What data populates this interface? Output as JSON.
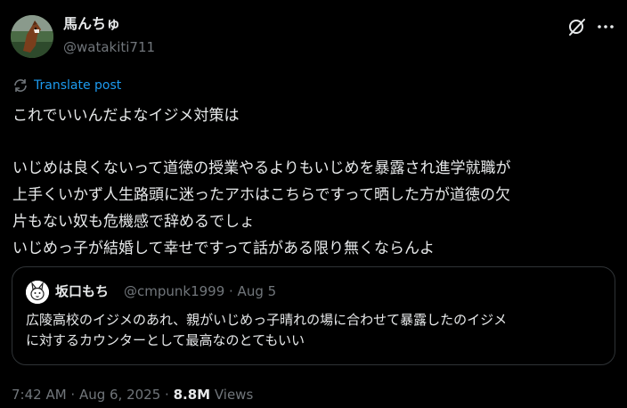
{
  "author": {
    "display_name": "馬んちゅ",
    "handle": "@watakiti711"
  },
  "translate": {
    "label": "Translate post"
  },
  "post": {
    "lines": [
      "これでいいんだよなイジメ対策は",
      "",
      "いじめは良くないって道徳の授業やるよりもいじめを暴露され進学就職が",
      "上手くいかず人生路頭に迷ったアホはこちらですって晒した方が道徳の欠",
      "片もない奴も危機感で辞めるでしょ",
      "いじめっ子が結婚して幸せですって話がある限り無くならんよ"
    ]
  },
  "quote": {
    "display_name": "坂口もち",
    "handle_date": "@cmpunk1999 · Aug 5",
    "lines": [
      "広陵高校のイジメのあれ、親がいじめっ子晴れの場に合わせて暴露したのイジメ",
      "に対するカウンターとして最高なのとてもいい"
    ]
  },
  "footer": {
    "timestamp": "7:42 AM · Aug 6, 2025 · ",
    "views_count": "8.8M",
    "views_label": " Views"
  },
  "colors": {
    "background": "#000000",
    "text": "#e7e9ea",
    "secondary": "#71767b",
    "link": "#1d9bf0",
    "border": "#2f3336"
  },
  "icons": {
    "grok": "grok-icon",
    "more": "more-icon",
    "translate": "translate-icon"
  }
}
